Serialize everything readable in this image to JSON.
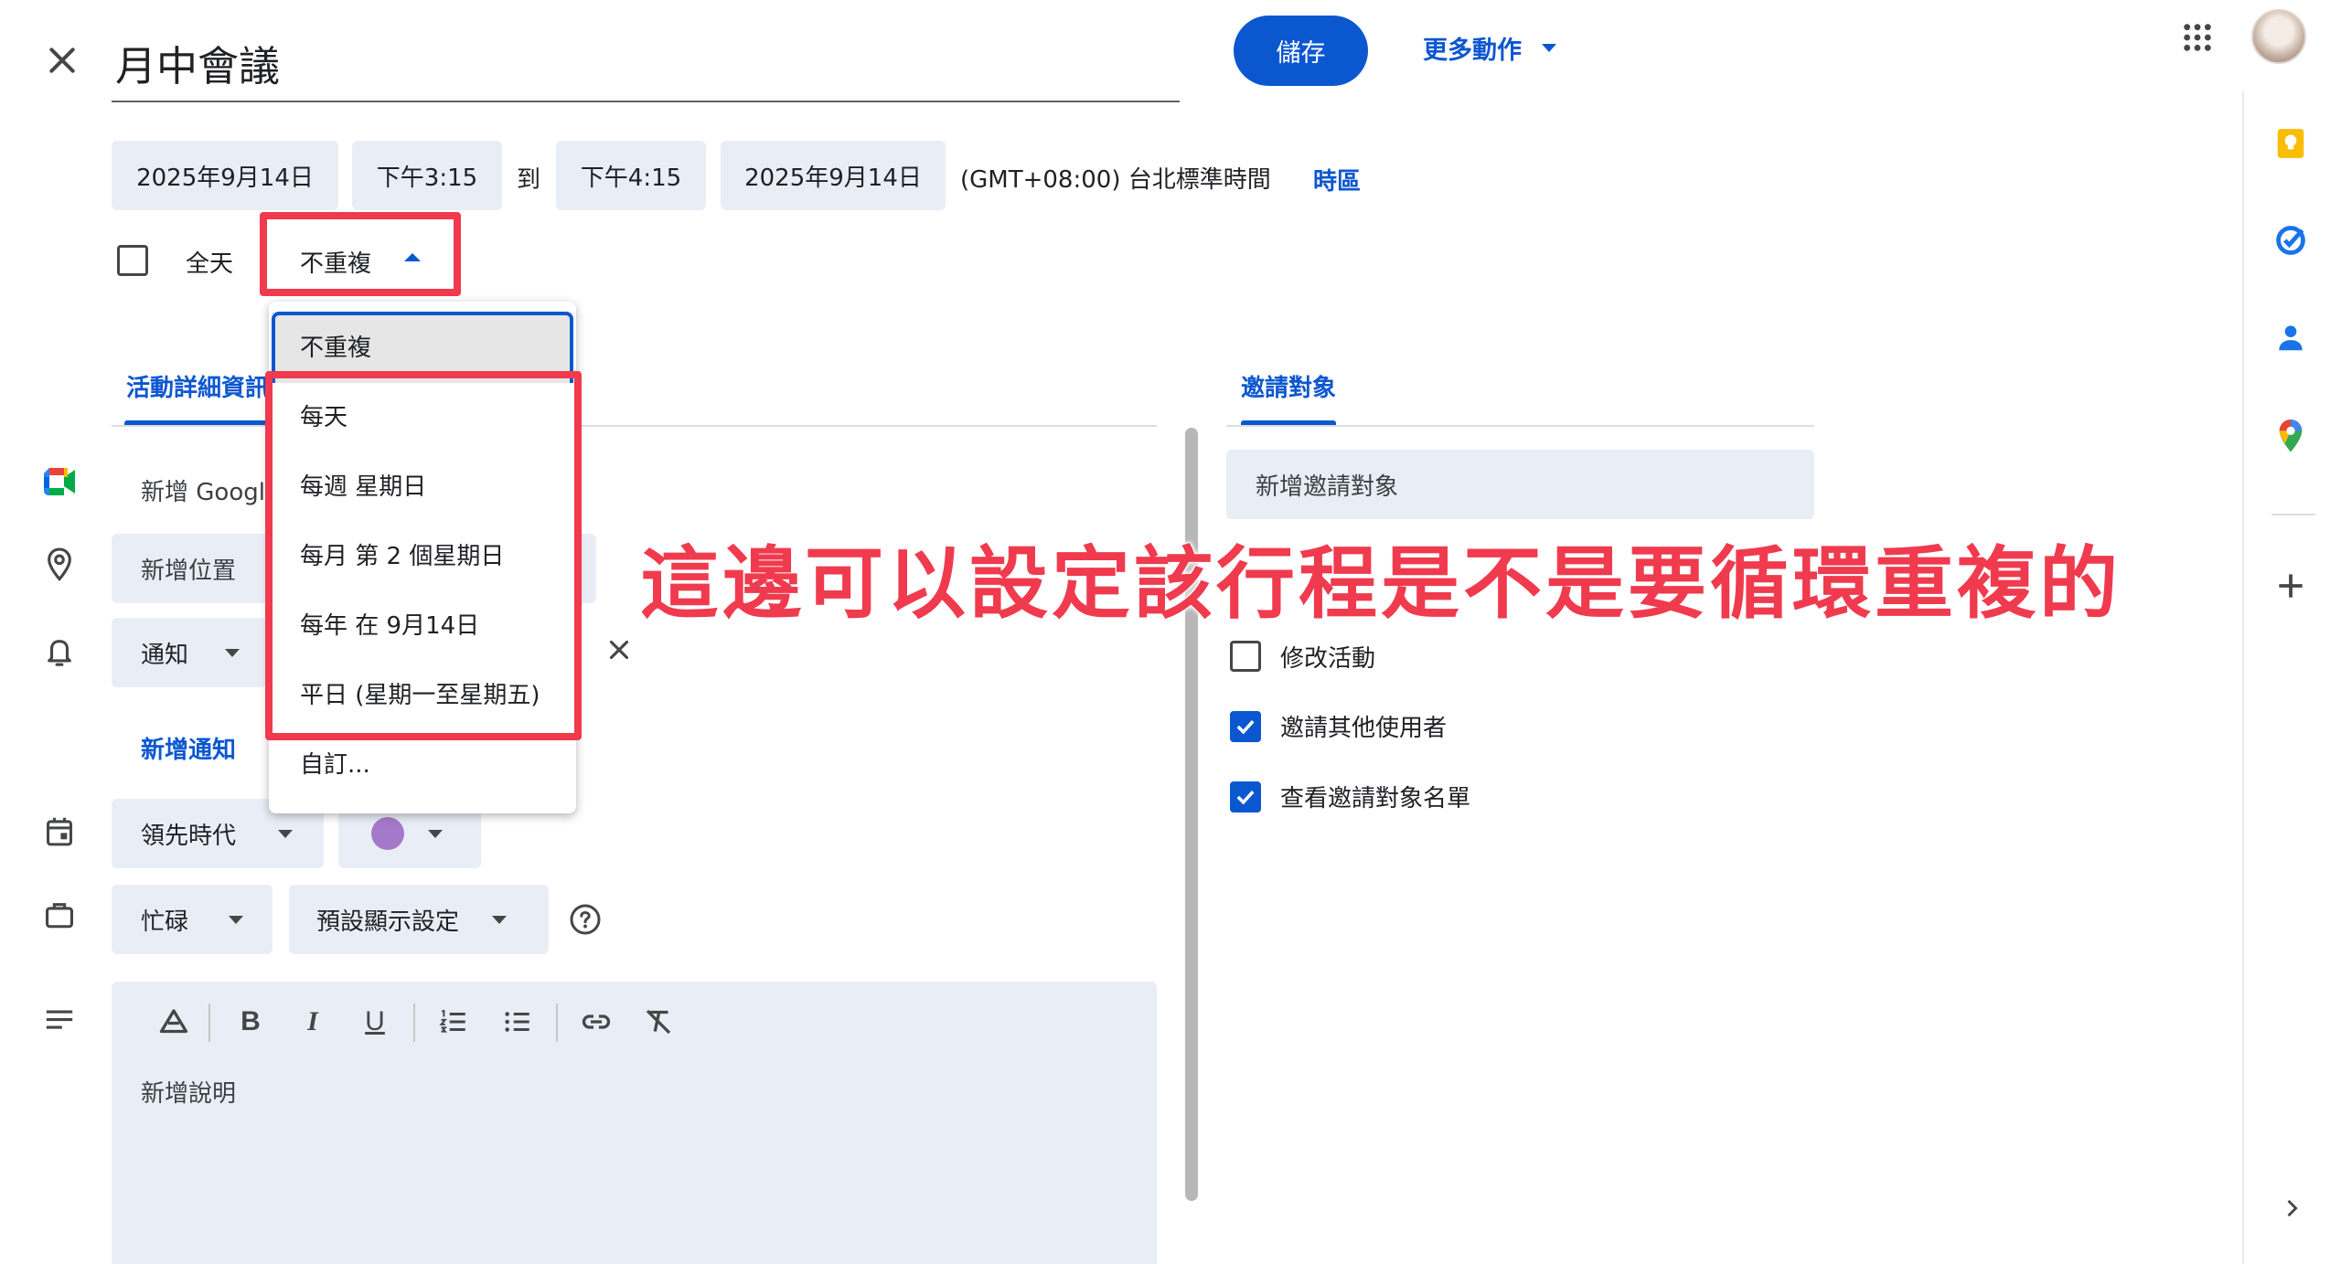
{
  "header": {
    "title": "月中會議",
    "save_label": "儲存",
    "more_actions_label": "更多動作"
  },
  "datetime": {
    "start_date": "2025年9月14日",
    "start_time": "下午3:15",
    "to_label": "到",
    "end_time": "下午4:15",
    "end_date": "2025年9月14日",
    "timezone_text": "(GMT+08:00) 台北標準時間",
    "timezone_link": "時區",
    "all_day_label": "全天",
    "all_day_checked": false,
    "repeat_selected": "不重複"
  },
  "repeat_menu": {
    "options": [
      "不重複",
      "每天",
      "每週 星期日",
      "每月 第 2 個星期日",
      "每年 在 9月14日",
      "平日 (星期一至星期五)",
      "自訂..."
    ]
  },
  "tabs": {
    "details": "活動詳細資訊",
    "guests": "邀請對象"
  },
  "details": {
    "meet_placeholder": "新增 Google",
    "location_placeholder": "新增位置",
    "notification_label": "通知",
    "add_notification": "新增通知",
    "calendar_name": "領先時代",
    "calendar_color": "#a579c9",
    "busy_label": "忙碌",
    "visibility_label": "預設顯示設定",
    "description_placeholder": "新增說明"
  },
  "guests": {
    "add_guests_placeholder": "新增邀請對象",
    "permissions": [
      {
        "label": "修改活動",
        "checked": false
      },
      {
        "label": "邀請其他使用者",
        "checked": true
      },
      {
        "label": "查看邀請對象名單",
        "checked": true
      }
    ]
  },
  "annotation": "這邊可以設定該行程是不是要循環重複的",
  "colors": {
    "accent": "#0b57d0",
    "highlight": "#f03a4e",
    "chip_bg": "#e9eef6"
  }
}
